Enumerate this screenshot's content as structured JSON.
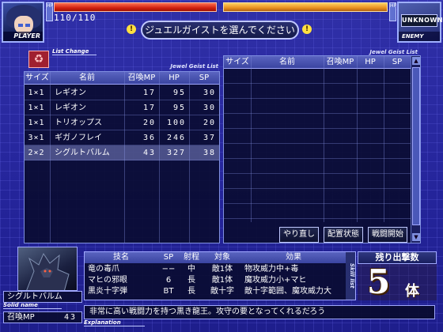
{
  "player": {
    "tag": "PLAYER",
    "hp": "110/110",
    "hp_marker": "HP"
  },
  "enemy": {
    "tag": "ENEMY",
    "name": "UNKNOWN"
  },
  "prompt": "ジュエルガイストを選んでください",
  "list_change": "List Change",
  "left_list": {
    "title": "Jewel Geist List",
    "columns": [
      "サイズ",
      "名前",
      "召喚MP",
      "HP",
      "SP"
    ],
    "rows": [
      {
        "size": "1×1",
        "name": "レギオン",
        "mp": "17",
        "hp": "95",
        "sp": "30"
      },
      {
        "size": "1×1",
        "name": "レギオン",
        "mp": "17",
        "hp": "95",
        "sp": "30"
      },
      {
        "size": "1×1",
        "name": "トリオップス",
        "mp": "20",
        "hp": "100",
        "sp": "20"
      },
      {
        "size": "3×1",
        "name": "ギガノフレイ",
        "mp": "36",
        "hp": "246",
        "sp": "37"
      },
      {
        "size": "2×2",
        "name": "シグルトバルム",
        "mp": "43",
        "hp": "327",
        "sp": "38"
      }
    ],
    "selected_index": 4
  },
  "right_list": {
    "title": "Jewel Geist List",
    "columns": [
      "サイズ",
      "名前",
      "召喚MP",
      "HP",
      "SP"
    ]
  },
  "buttons": {
    "redo": "やり直し",
    "placement": "配置状態",
    "start": "戦闘開始"
  },
  "monster": {
    "name": "シグルトバルム",
    "name_label": "Solid name",
    "mp_label": "召喚MP",
    "mp_value": "43"
  },
  "skills": {
    "side_label": "Skill list",
    "columns": [
      "技名",
      "SP",
      "射程",
      "対象",
      "効果"
    ],
    "rows": [
      {
        "name": "竜の毒爪",
        "sp": "−−",
        "range": "中",
        "target": "敵1体",
        "effect": "物攻威力中+毒"
      },
      {
        "name": "マヒの邪眼",
        "sp": "6",
        "range": "長",
        "target": "敵1体",
        "effect": "魔攻威力小+マヒ"
      },
      {
        "name": "黒炎十字弾",
        "sp": "BT",
        "range": "長",
        "target": "敵十字",
        "effect": "敵十字範囲、魔攻威力大"
      }
    ]
  },
  "remaining": {
    "label": "残り出撃数",
    "count": "5",
    "unit": "体"
  },
  "explanation": {
    "text": "非常に高い戦闘力を持つ黒き龍王。攻守の要となってくれるだろう",
    "label": "Explanation"
  },
  "colors": {
    "bg": "#2a2a9a",
    "panel": "#0a0c32",
    "hp_left": "#d02010",
    "hp_right": "#e89020",
    "accent": "#ffe040"
  },
  "icons": [
    "list-change-icon",
    "excl-icon",
    "scroll-up-icon",
    "scroll-down-icon"
  ]
}
